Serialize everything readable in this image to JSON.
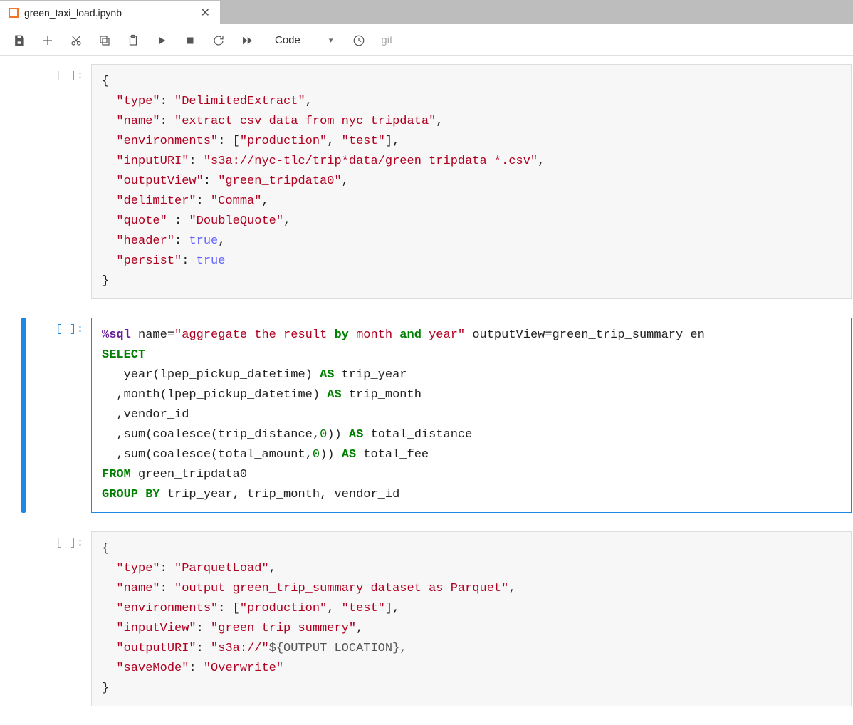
{
  "tab": {
    "title": "green_taxi_load.ipynb"
  },
  "toolbar": {
    "cell_type": "Code",
    "git": "git"
  },
  "prompts": {
    "empty": "[ ]:"
  },
  "cells": {
    "c1": {
      "open": "{",
      "l1k": "\"type\"",
      "l1v": "\"DelimitedExtract\"",
      "l2k": "\"name\"",
      "l2v": "\"extract csv data from nyc_tripdata\"",
      "l3k": "\"environments\"",
      "l3v1": "\"production\"",
      "l3v2": "\"test\"",
      "l4k": "\"inputURI\"",
      "l4v": "\"s3a://nyc-tlc/trip*data/green_tripdata_*.csv\"",
      "l5k": "\"outputView\"",
      "l5v": "\"green_tripdata0\"",
      "l6k": "\"delimiter\"",
      "l6v": "\"Comma\"",
      "l7k": "\"quote\"",
      "l7v": "\"DoubleQuote\"",
      "l8k": "\"header\"",
      "l8v": "true",
      "l9k": "\"persist\"",
      "l9v": "true",
      "close": "}"
    },
    "c2": {
      "magic": "%sql",
      "attr_name_k": "name=",
      "attr_name_v": "\"aggregate the result ",
      "attr_by": "by",
      "attr_mid": " month ",
      "attr_and": "and",
      "attr_tail": " year\"",
      "attr_out": " outputView=green_trip_summary en",
      "select": "SELECT",
      "y_fn": "year",
      "y_arg": "lpep_pickup_datetime",
      "as": "AS",
      "y_alias": "trip_year",
      "m_fn": "month",
      "m_arg": "lpep_pickup_datetime",
      "m_alias": "trip_month",
      "vendor": "vendor_id",
      "sum1_fn": "sum",
      "coalesce": "coalesce",
      "td": "trip_distance",
      "zero": "0",
      "total_distance": "total_distance",
      "ta": "total_amount",
      "total_fee": "total_fee",
      "from": "FROM",
      "table": "green_tripdata0",
      "group_by": "GROUP BY",
      "gb_cols": "trip_year, trip_month, vendor_id"
    },
    "c3": {
      "open": "{",
      "l1k": "\"type\"",
      "l1v": "\"ParquetLoad\"",
      "l2k": "\"name\"",
      "l2v": "\"output green_trip_summary dataset as Parquet\"",
      "l3k": "\"environments\"",
      "l3v1": "\"production\"",
      "l3v2": "\"test\"",
      "l4k": "\"inputView\"",
      "l4v": "\"green_trip_summery\"",
      "l5k": "\"outputURI\"",
      "l5v": "\"s3a://\"",
      "l5var": "${OUTPUT_LOCATION},",
      "l6k": "\"saveMode\"",
      "l6v": "\"Overwrite\"",
      "close": "}"
    }
  }
}
